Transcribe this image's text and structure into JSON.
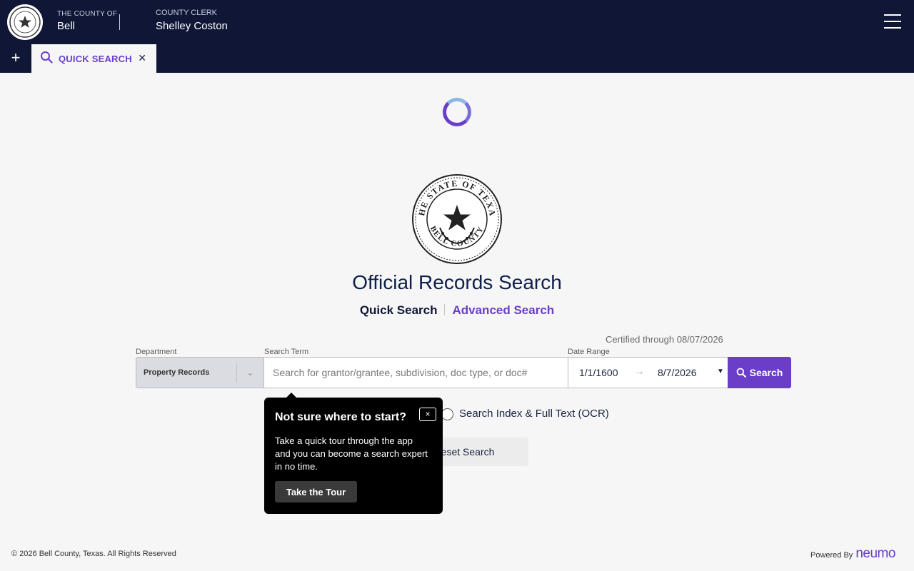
{
  "header": {
    "county_kicker": "THE COUNTY OF",
    "county_name": "Bell",
    "clerk_kicker": "COUNTY CLERK",
    "clerk_name": "Shelley Coston",
    "menu_icon": "hamburger-menu-icon",
    "seal_text": "THE STATE OF TEXAS · BELL COUNTY"
  },
  "tabs": {
    "add_icon": "plus-icon",
    "items": [
      {
        "label": "QUICK SEARCH",
        "icon": "search-icon",
        "close_icon": "close-icon",
        "active": true
      }
    ]
  },
  "main": {
    "title": "Official Records Search",
    "mode_quick": "Quick Search",
    "mode_advanced": "Advanced Search",
    "certified": "Certified through 08/07/2026"
  },
  "form": {
    "department_label": "Department",
    "department_value": "Property Records",
    "term_label": "Search Term",
    "term_placeholder": "Search for grantor/grantee, subdivision, doc type, or doc#",
    "term_value": "",
    "date_label": "Date Range",
    "date_from": "1/1/1600",
    "date_to": "8/7/2026",
    "search_button": "Search",
    "ocr_option": "Search Index & Full Text (OCR)",
    "reset_button": "Reset Search"
  },
  "popover": {
    "title": "Not sure where to start?",
    "body": "Take a quick tour through the app and you can become a search expert in no time.",
    "button": "Take the Tour",
    "close_symbol": "×"
  },
  "footer": {
    "copyright": "© 2026 Bell County, Texas. All Rights Reserved",
    "powered_by": "Powered By",
    "brand": "neumo"
  },
  "colors": {
    "navy": "#0f1636",
    "accent": "#6a3ec9",
    "background": "#f6f6f6"
  }
}
